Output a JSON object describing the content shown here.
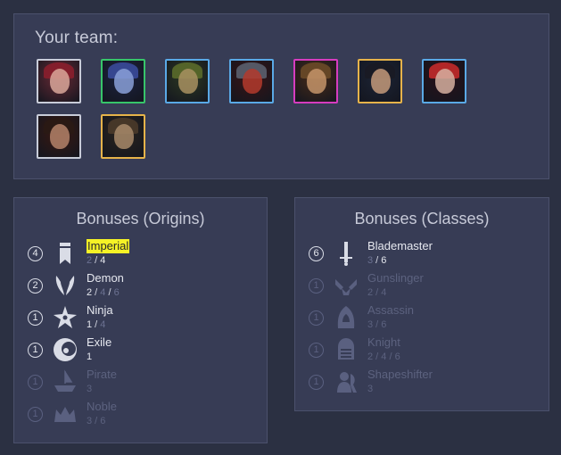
{
  "team": {
    "title": "Your team:",
    "champions": [
      {
        "name": "champion-1",
        "border": "#c8ccd9",
        "bg": "#6b2a35",
        "hair": "#8a1e2c",
        "face": "#d9a79a"
      },
      {
        "name": "champion-2",
        "border": "#37c56a",
        "bg": "#1c2240",
        "hair": "#3a4a9a",
        "face": "#8aa0d8"
      },
      {
        "name": "champion-3",
        "border": "#5aa9e6",
        "bg": "#2d3a22",
        "hair": "#5a6a2a",
        "face": "#a89060"
      },
      {
        "name": "champion-4",
        "border": "#5aa9e6",
        "bg": "#3a1414",
        "hair": "#5a5f6e",
        "face": "#b3392d"
      },
      {
        "name": "champion-5",
        "border": "#d63cbf",
        "bg": "#4a2c18",
        "hair": "#6a4a28",
        "face": "#c4946a"
      },
      {
        "name": "champion-6",
        "border": "#e6b34a",
        "bg": "#1c2436",
        "hair": "#1a1a24",
        "face": "#c49a7a"
      },
      {
        "name": "champion-7",
        "border": "#5aa9e6",
        "bg": "#2a1018",
        "hair": "#c22a2a",
        "face": "#d6b0a0"
      },
      {
        "name": "champion-8",
        "border": "#c8ccd9",
        "bg": "#3a1810",
        "hair": "#2a1a14",
        "face": "#b4826a"
      },
      {
        "name": "champion-9",
        "border": "#e6b34a",
        "bg": "#2a241c",
        "hair": "#4a3a2a",
        "face": "#a88a6a"
      }
    ]
  },
  "origins": {
    "title": "Bonuses (Origins)",
    "items": [
      {
        "name": "Imperial",
        "count": "4",
        "icon": "banner-icon",
        "tiers": [
          "2",
          "4"
        ],
        "active": [
          false,
          true
        ],
        "highlight": true,
        "state": "active"
      },
      {
        "name": "Demon",
        "count": "2",
        "icon": "horns-icon",
        "tiers": [
          "2",
          "4",
          "6"
        ],
        "active": [
          true,
          false,
          false
        ],
        "highlight": false,
        "state": "active"
      },
      {
        "name": "Ninja",
        "count": "1",
        "icon": "shuriken-icon",
        "tiers": [
          "1",
          "4"
        ],
        "active": [
          true,
          false
        ],
        "highlight": false,
        "state": "active"
      },
      {
        "name": "Exile",
        "count": "1",
        "icon": "crescent-icon",
        "tiers": [
          "1"
        ],
        "active": [
          true
        ],
        "highlight": false,
        "state": "active"
      },
      {
        "name": "Pirate",
        "count": "1",
        "icon": "ship-icon",
        "tiers": [
          "3"
        ],
        "active": [
          false
        ],
        "highlight": false,
        "state": "inactive"
      },
      {
        "name": "Noble",
        "count": "1",
        "icon": "crown-icon",
        "tiers": [
          "3",
          "6"
        ],
        "active": [
          false,
          false
        ],
        "highlight": false,
        "state": "inactive"
      }
    ]
  },
  "classes": {
    "title": "Bonuses (Classes)",
    "items": [
      {
        "name": "Blademaster",
        "count": "6",
        "icon": "sword-icon",
        "tiers": [
          "3",
          "6"
        ],
        "active": [
          false,
          true
        ],
        "highlight": false,
        "state": "active"
      },
      {
        "name": "Gunslinger",
        "count": "1",
        "icon": "pistols-icon",
        "tiers": [
          "2",
          "4"
        ],
        "active": [
          false,
          false
        ],
        "highlight": false,
        "state": "inactive"
      },
      {
        "name": "Assassin",
        "count": "1",
        "icon": "hood-icon",
        "tiers": [
          "3",
          "6"
        ],
        "active": [
          false,
          false
        ],
        "highlight": false,
        "state": "inactive"
      },
      {
        "name": "Knight",
        "count": "1",
        "icon": "helmet-icon",
        "tiers": [
          "2",
          "4",
          "6"
        ],
        "active": [
          false,
          false,
          false
        ],
        "highlight": false,
        "state": "inactive"
      },
      {
        "name": "Shapeshifter",
        "count": "1",
        "icon": "shapeshifter-icon",
        "tiers": [
          "3"
        ],
        "active": [
          false
        ],
        "highlight": false,
        "state": "inactive"
      }
    ]
  }
}
